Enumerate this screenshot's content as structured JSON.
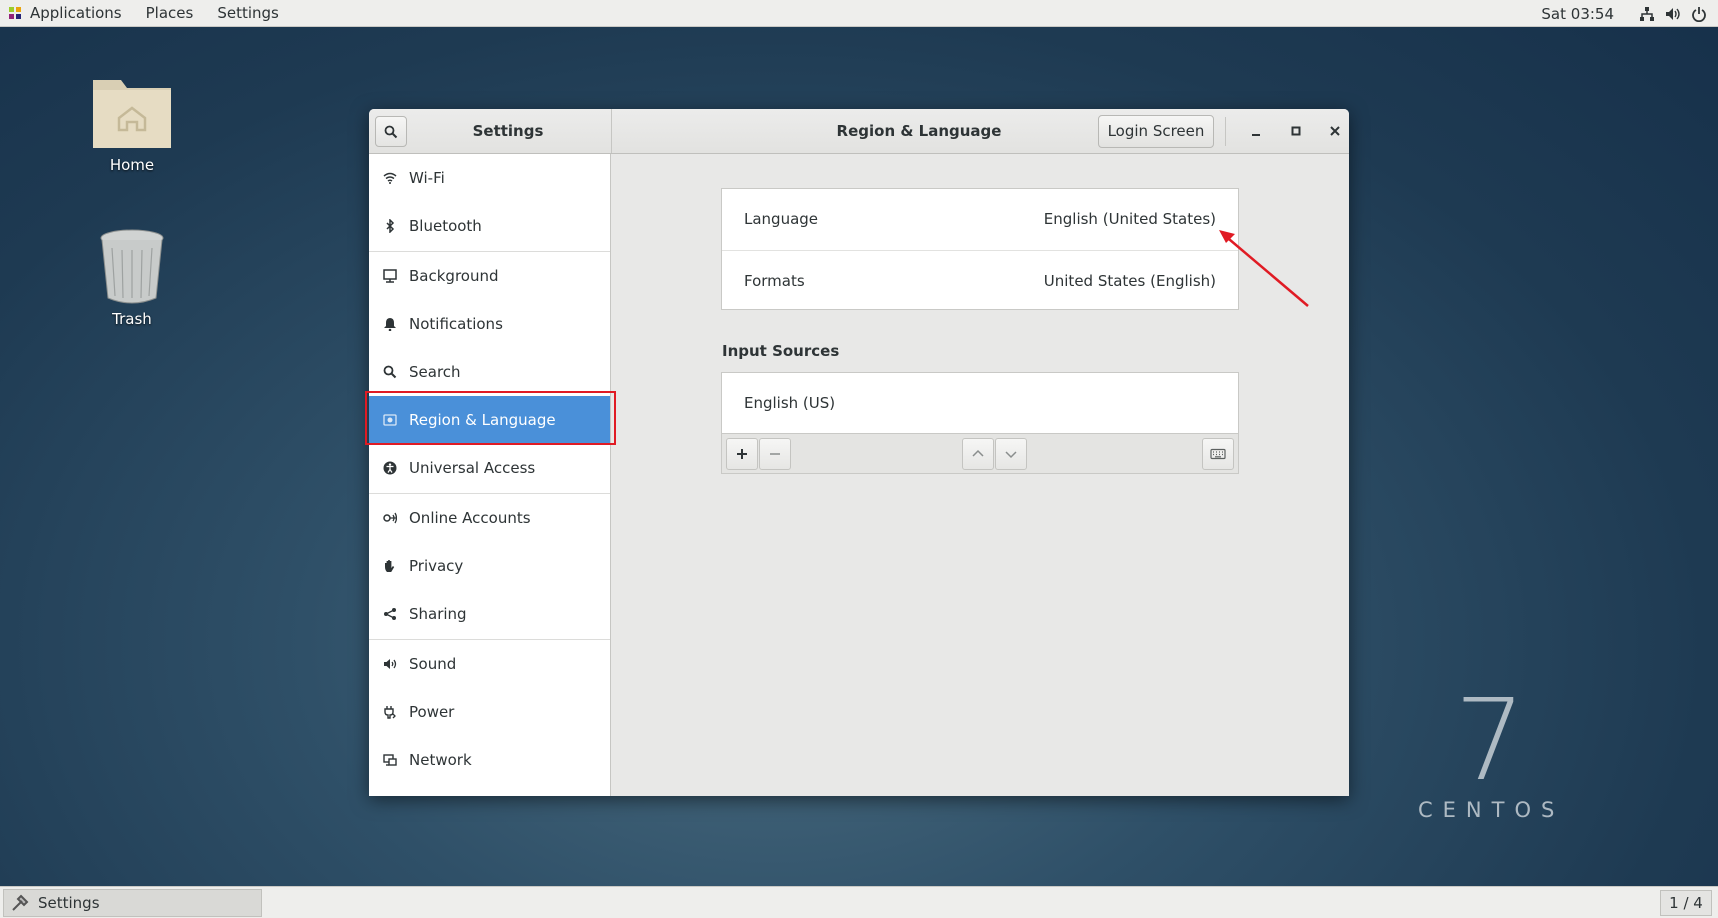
{
  "topbar": {
    "menus": [
      "Applications",
      "Places",
      "Settings"
    ],
    "clock": "Sat 03:54",
    "tray_icons": [
      "network-icon",
      "volume-icon",
      "power-icon"
    ]
  },
  "desktop": {
    "icons": [
      {
        "label": "Home",
        "icon": "folder-home-icon"
      },
      {
        "label": "Trash",
        "icon": "trash-icon"
      }
    ],
    "branding": {
      "number": "7",
      "word": "CENTOS"
    }
  },
  "window": {
    "sidebar_title": "Settings",
    "page_title": "Region & Language",
    "login_screen_button": "Login Screen",
    "sidebar": [
      {
        "label": "Wi-Fi",
        "icon": "wifi-icon"
      },
      {
        "label": "Bluetooth",
        "icon": "bluetooth-icon"
      },
      {
        "label": "Background",
        "icon": "background-icon"
      },
      {
        "label": "Notifications",
        "icon": "bell-icon"
      },
      {
        "label": "Search",
        "icon": "search-icon"
      },
      {
        "label": "Region & Language",
        "icon": "region-icon",
        "selected": true
      },
      {
        "label": "Universal Access",
        "icon": "accessibility-icon"
      },
      {
        "label": "Online Accounts",
        "icon": "online-accounts-icon"
      },
      {
        "label": "Privacy",
        "icon": "hand-icon"
      },
      {
        "label": "Sharing",
        "icon": "share-icon"
      },
      {
        "label": "Sound",
        "icon": "speaker-icon"
      },
      {
        "label": "Power",
        "icon": "power-plug-icon"
      },
      {
        "label": "Network",
        "icon": "network-icon"
      }
    ],
    "content": {
      "language": {
        "label": "Language",
        "value": "English (United States)"
      },
      "formats": {
        "label": "Formats",
        "value": "United States (English)"
      },
      "input_sources_title": "Input Sources",
      "input_sources": [
        "English (US)"
      ]
    }
  },
  "taskbar": {
    "task": "Settings",
    "workspace": "1 / 4"
  },
  "colors": {
    "selection": "#4a90d9",
    "annotation": "#e01b24"
  }
}
